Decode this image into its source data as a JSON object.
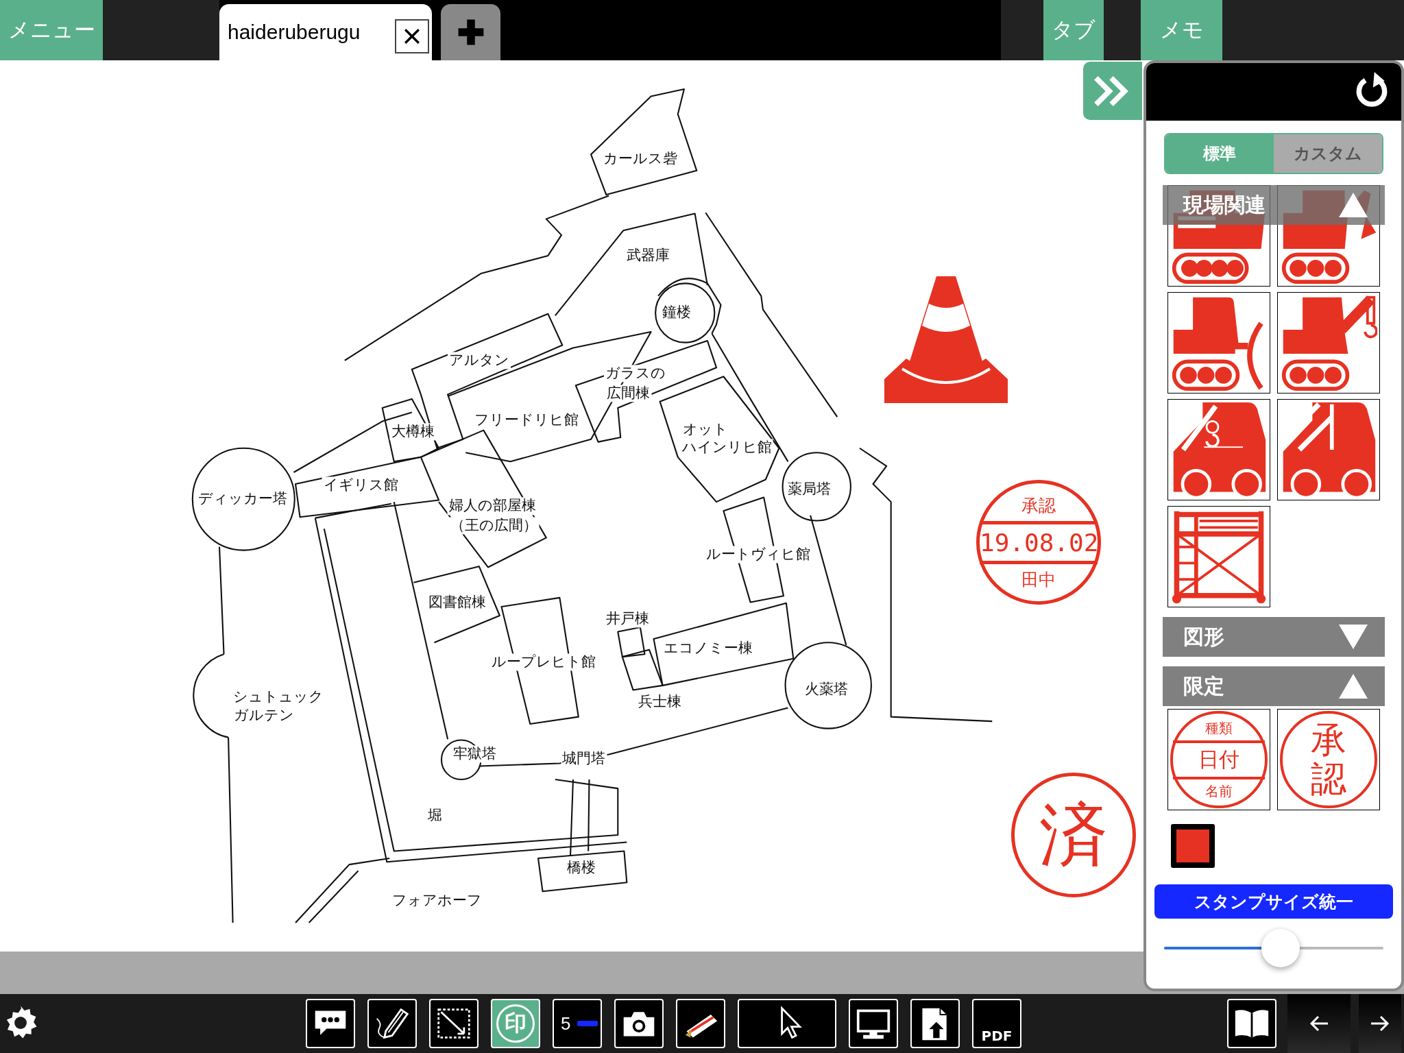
{
  "top_bar": {
    "menu_button": "メニュー",
    "tabs": [
      {
        "label": "haideruberugu",
        "selected": true
      }
    ],
    "buttons": [
      "タブ",
      "メモ"
    ]
  },
  "canvas": {
    "labels": [
      "カールス砦",
      "武器庫",
      "鐘楼",
      "アルタン",
      "ガラスの",
      "広間棟",
      "フリードリヒ館",
      "大樽棟",
      "オット",
      "ハインリヒ館",
      "イギリス館",
      "ディッカー塔",
      "婦人の部屋棟",
      "（王の広間）",
      "薬局塔",
      "ルートヴィヒ館",
      "図書館棟",
      "井戸棟",
      "エコノミー棟",
      "ループレヒト館",
      "シュトュック",
      "ガルテン",
      "火薬塔",
      "兵士棟",
      "牢獄塔",
      "城門塔",
      "堀",
      "橋楼",
      "フォアホーフ"
    ],
    "stamps": [
      {
        "kind": "cone"
      },
      {
        "kind": "date-seal",
        "top": "承認",
        "middle": "19.08.02",
        "bottom": "田中"
      },
      {
        "kind": "char-seal",
        "text": "済"
      }
    ]
  },
  "panel": {
    "segments": [
      {
        "label": "標準",
        "selected": true
      },
      {
        "label": "カスタム",
        "selected": false
      }
    ],
    "sections": [
      {
        "title": "現場関連",
        "expanded": true,
        "stamps": [
          {
            "kind": "crawler-carrier"
          },
          {
            "kind": "excavator"
          },
          {
            "kind": "bulldozer"
          },
          {
            "kind": "crawler-crane"
          },
          {
            "kind": "crane-truck"
          },
          {
            "kind": "mixer-truck"
          },
          {
            "kind": "scaffold"
          }
        ]
      },
      {
        "title": "図形",
        "expanded": false
      },
      {
        "title": "限定",
        "expanded": true,
        "stamps": [
          {
            "kind": "date-seal",
            "top": "種類",
            "middle": "日付",
            "bottom": "名前"
          },
          {
            "kind": "char-seal",
            "text": "承認"
          }
        ]
      }
    ],
    "color": "#e63222",
    "size_button": "スタンプサイズ統一",
    "size": {
      "level": 0.53
    }
  },
  "toolbar": {
    "tools": [
      {
        "kind": "comment",
        "selected": false
      },
      {
        "kind": "pen",
        "selected": false
      },
      {
        "kind": "select",
        "selected": false
      },
      {
        "kind": "stamp",
        "label": "印",
        "selected": true
      },
      {
        "kind": "line-width",
        "label": "5",
        "selected": false
      },
      {
        "kind": "camera",
        "selected": false
      },
      {
        "kind": "ruler",
        "selected": false
      },
      {
        "kind": "pointer",
        "selected": false
      },
      {
        "kind": "screen",
        "selected": false
      },
      {
        "kind": "export",
        "selected": false
      },
      {
        "kind": "pdf",
        "label": "PDF",
        "selected": false
      }
    ]
  }
}
